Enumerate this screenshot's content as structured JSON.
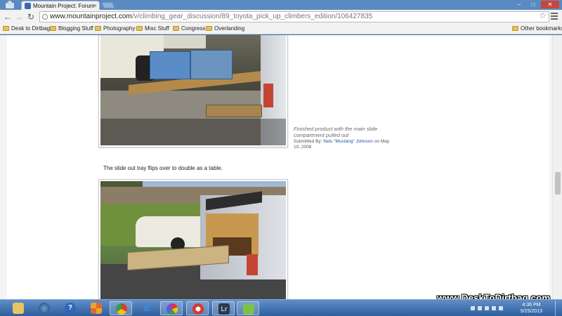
{
  "browser": {
    "tab_title": "Mountain Project: Forum",
    "tab_close": "×",
    "url_domain": "www.mountainproject.com",
    "url_path": "/v/climbing_gear_discussion/89_toyota_pick_up_climbers_edition/106427835",
    "back_glyph": "←",
    "forward_glyph": "→",
    "reload_glyph": "↻",
    "star_glyph": "☆",
    "win_min": "–",
    "win_max": "□",
    "win_close": "✕"
  },
  "bookmarks": {
    "items": [
      "Desk to Dirtbag",
      "Blogging Stuff",
      "Photography",
      "Misc Stuff",
      "Congress",
      "Overlanding"
    ],
    "other": "Other bookmarks"
  },
  "post": {
    "caption": "Finished product with the main slide compartment pulled out",
    "submitted_prefix": "Submitted By:",
    "submitted_by": "Nels \"Mustang\" Johnson",
    "submitted_on": "on May 10, 2008",
    "paragraph": "The slide out tray flips over to double as a table."
  },
  "taskbar": {
    "icons": [
      "file-explorer-icon",
      "media-player-icon",
      "help-icon",
      "app-grid-icon",
      "chrome-icon",
      "internet-explorer-icon",
      "picasa-icon",
      "app-red-icon",
      "lightroom-icon",
      "evernote-icon"
    ],
    "lightroom_label": "Lr",
    "help_label": "?",
    "clock_time": "4:36 PM",
    "clock_date": "5/25/2013"
  },
  "watermark": "www.DeskToDirtbag.com",
  "colors": {
    "taskbar": "#2f5e9c",
    "link": "#1a56a8",
    "caption": "#6b6b6b"
  }
}
